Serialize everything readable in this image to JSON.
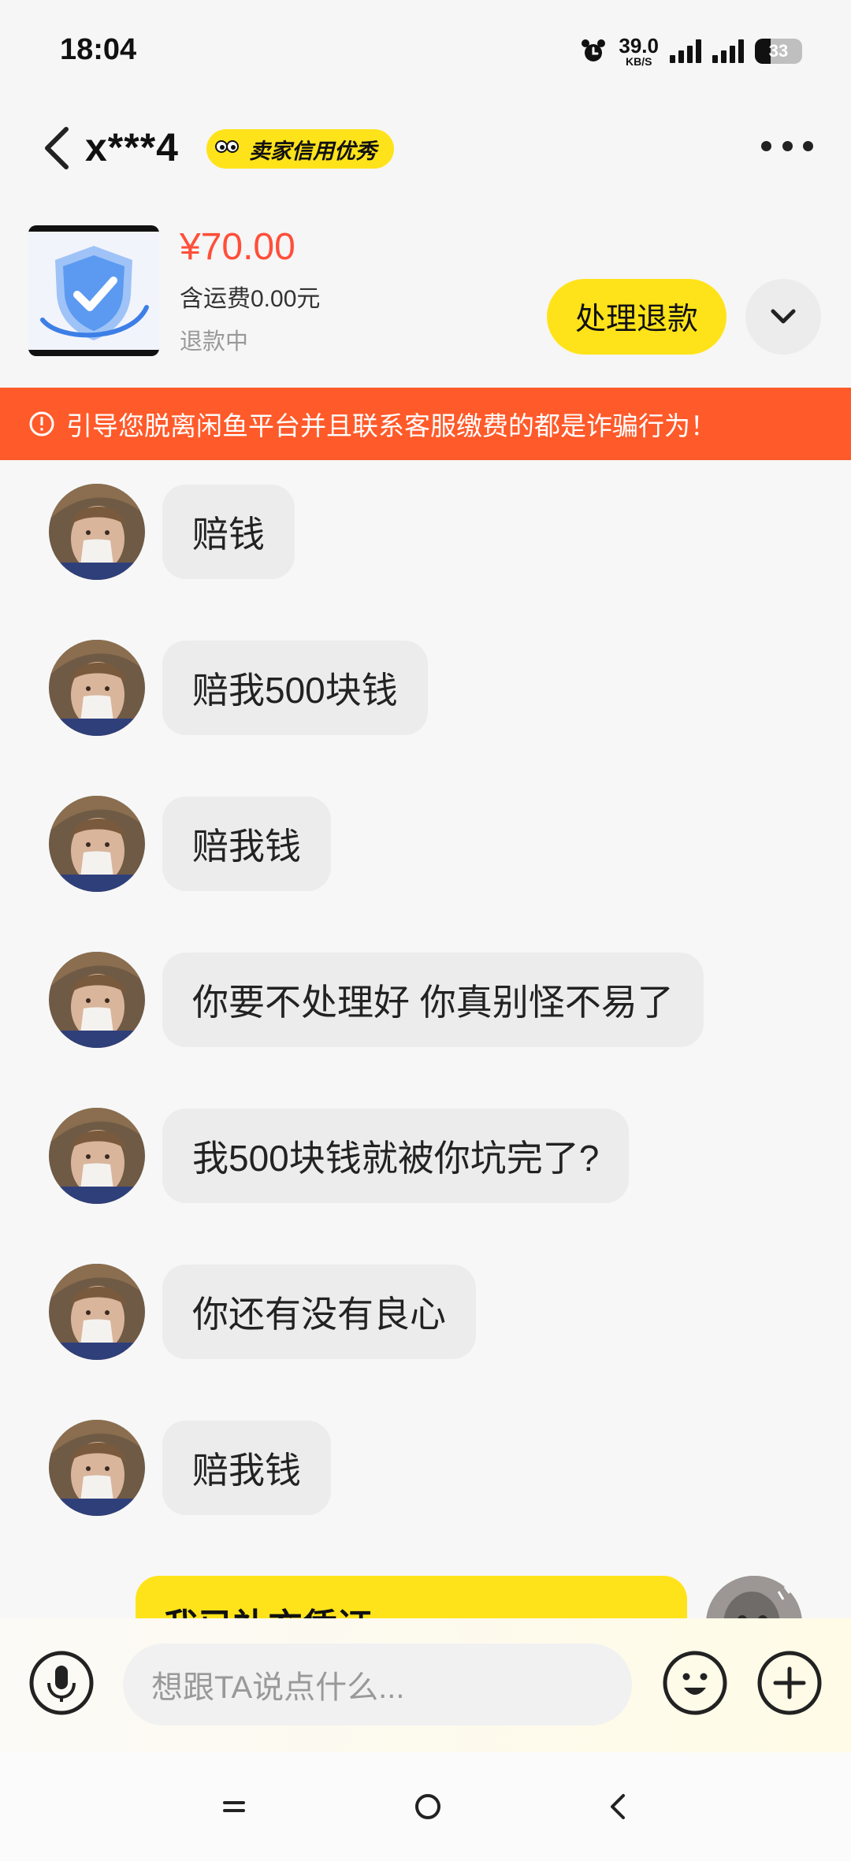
{
  "status_bar": {
    "time": "18:04",
    "net_speed": "39.0",
    "net_unit": "KB/S",
    "battery": "33",
    "battery_level": 0.33
  },
  "header": {
    "title": "x***4",
    "badge": "卖家信用优秀"
  },
  "product": {
    "price": "¥70.00",
    "shipping": "含运费0.00元",
    "status": "退款中",
    "action_label": "处理退款"
  },
  "warning": {
    "text": "引导您脱离闲鱼平台并且联系客服缴费的都是诈骗行为！"
  },
  "messages": [
    {
      "text": "赔钱"
    },
    {
      "text": "赔我500块钱"
    },
    {
      "text": "赔我钱"
    },
    {
      "text": "你要不处理好 你真别怪不易了"
    },
    {
      "text": "我500块钱就被你坑完了?"
    },
    {
      "text": "你还有没有良心"
    },
    {
      "text": "赔我钱"
    }
  ],
  "outgoing": {
    "text": "我已补充凭证"
  },
  "input": {
    "placeholder": "想跟TA说点什么..."
  },
  "colors": {
    "accent": "#ffe31a",
    "price": "#ff4f3a",
    "warning_bg": "#ff5a2a"
  }
}
